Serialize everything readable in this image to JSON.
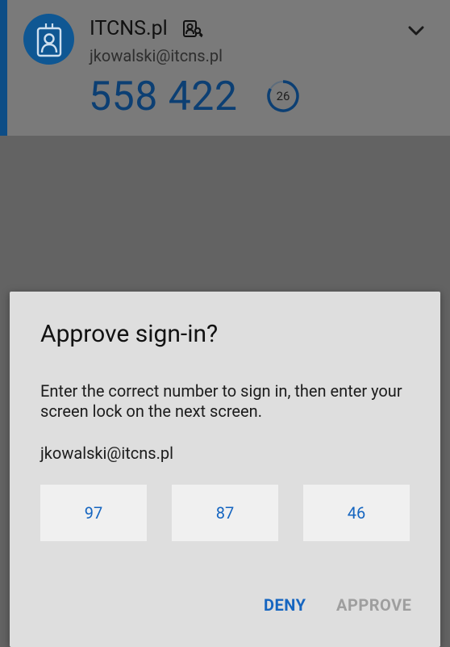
{
  "account": {
    "name": "ITCNS.pl",
    "email": "jkowalski@itcns.pl",
    "code": "558 422",
    "timer_seconds": "26",
    "icons": {
      "avatar": "id-badge-icon",
      "badge": "passwordless-key-icon",
      "expand": "chevron-down-icon"
    }
  },
  "dialog": {
    "title": "Approve sign-in?",
    "message": "Enter the correct number to sign in, then enter your screen lock on the next screen.",
    "account_email": "jkowalski@itcns.pl",
    "number_options": [
      "97",
      "87",
      "46"
    ],
    "deny_label": "DENY",
    "approve_label": "APPROVE"
  },
  "colors": {
    "accent": "#0d4d86",
    "link": "#1565c0",
    "disabled": "#9e9e9e",
    "scrim": "#636363",
    "dialog_bg": "#dedede"
  }
}
